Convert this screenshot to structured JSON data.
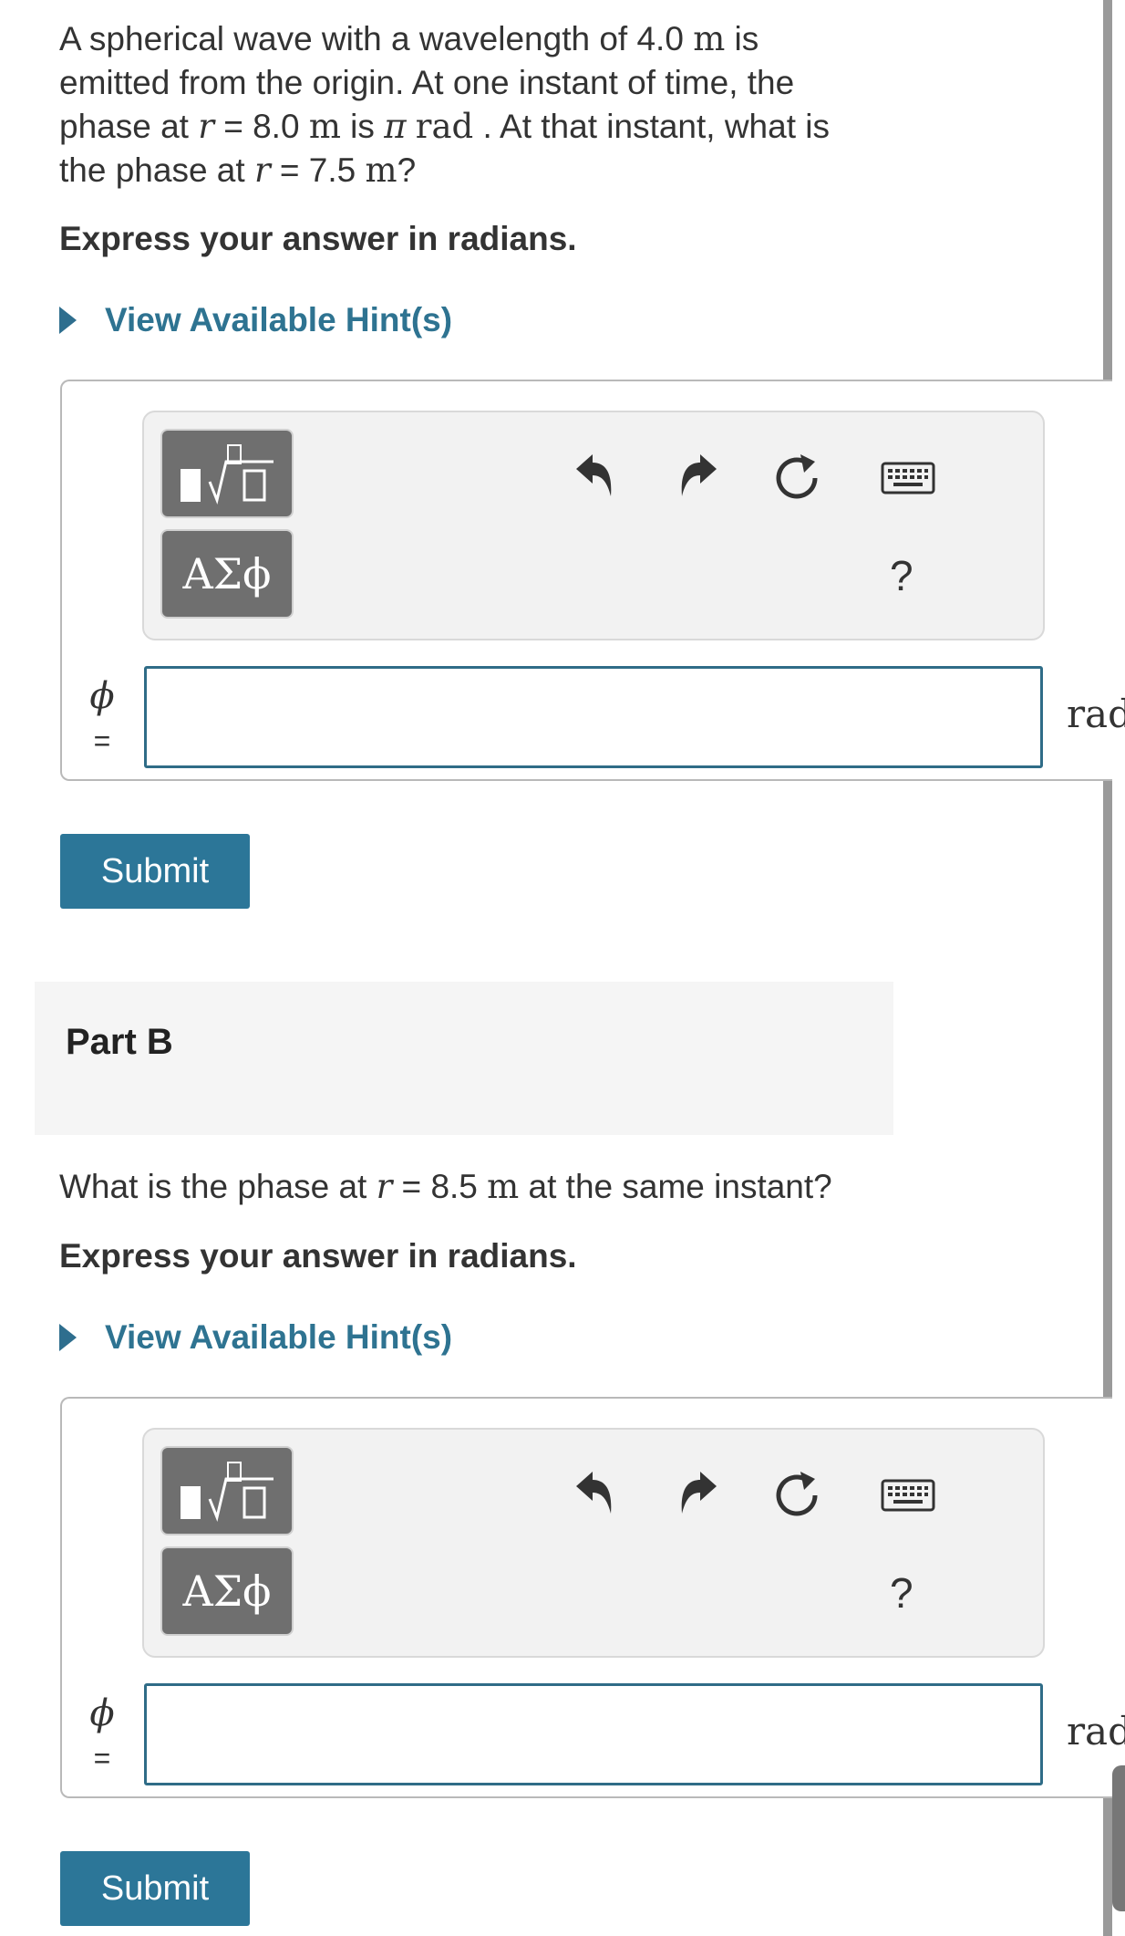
{
  "partA": {
    "question": {
      "t1": "A spherical wave with a wavelength of 4.0 ",
      "u1": "m",
      "t2": " is",
      "t3": "emitted from the origin. At one instant of time, the",
      "t4": "phase at ",
      "v1": "r",
      "t5": " = 8.0 ",
      "u2": "m",
      "t6": " is ",
      "pi": "π",
      "u3": "rad",
      "t7": " . At that instant, what is",
      "t8": "the phase at ",
      "v2": "r",
      "t9": " = 7.5 ",
      "u4": "m",
      "t10": "?"
    },
    "express": "Express your answer in radians.",
    "hint_label": "View Available Hint(s)",
    "toolbar": {
      "greek": "ΑΣϕ",
      "help": "?"
    },
    "answer": {
      "variable": "ϕ",
      "equals": "=",
      "value": "",
      "unit": "rad"
    },
    "submit": "Submit"
  },
  "partB": {
    "title": "Part B",
    "question": {
      "t1": "What is the phase at ",
      "v1": "r",
      "t2": " = 8.5 ",
      "u1": "m",
      "t3": " at the same instant?"
    },
    "express": "Express your answer in radians.",
    "hint_label": "View Available Hint(s)",
    "toolbar": {
      "greek": "ΑΣϕ",
      "help": "?"
    },
    "answer": {
      "variable": "ϕ",
      "equals": "=",
      "value": "",
      "unit": "rad"
    },
    "submit": "Submit"
  },
  "colors": {
    "accent": "#2c7698",
    "hint_text": "#2e7391",
    "input_border": "#2f6c87",
    "tool_button": "#6f6f6f"
  },
  "icons": [
    "template-icon",
    "undo-icon",
    "redo-icon",
    "reset-icon",
    "keyboard-icon",
    "play-triangle-icon"
  ]
}
